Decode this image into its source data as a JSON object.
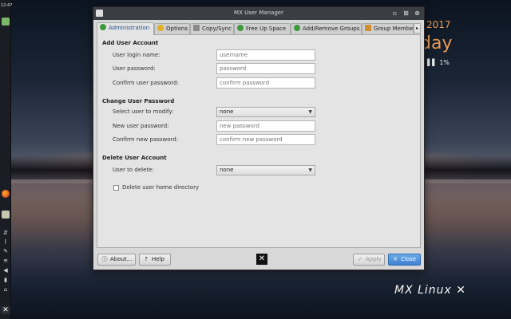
{
  "panel": {
    "clock": "12:47",
    "icons": [
      "users-icon",
      "firefox-icon",
      "files-icon",
      "network-icon",
      "bluetooth-icon",
      "clipboard-icon",
      "wifi-icon",
      "volume-icon",
      "battery-icon",
      "home-icon",
      "mx-menu-icon"
    ]
  },
  "desktop": {
    "conky_year": "2017",
    "conky_day": "day",
    "conky_percent_icon": "▐▐",
    "conky_percent": "1%",
    "brand": "MX Linux"
  },
  "window": {
    "title": "MX User Manager",
    "tabs": [
      {
        "label": "Administration",
        "icon": "user-admin-icon",
        "color": "#3d9a3d"
      },
      {
        "label": "Options",
        "icon": "options-icon",
        "color": "#e0b020"
      },
      {
        "label": "Copy/Sync",
        "icon": "copy-icon",
        "color": "#8a8a8a"
      },
      {
        "label": "Free Up Space",
        "icon": "user-icon",
        "color": "#3d9a3d"
      },
      {
        "label": "Add/Remove Groups",
        "icon": "group-icon",
        "color": "#3d9a3d"
      },
      {
        "label": "Group Members",
        "icon": "members-icon",
        "color": "#d09030"
      }
    ],
    "tab_scroll": "▸",
    "add_section": {
      "title": "Add User Account",
      "login_label": "User login name:",
      "login_placeholder": "username",
      "password_label": "User password:",
      "password_placeholder": "password",
      "confirm_label": "Confirm user password:",
      "confirm_placeholder": "confirm password"
    },
    "change_section": {
      "title": "Change User Password",
      "select_label": "Select user to modify:",
      "select_value": "none",
      "new_label": "New user password:",
      "new_placeholder": "new password",
      "confirm_label": "Confirm new password:",
      "confirm_placeholder": "confirm new password"
    },
    "delete_section": {
      "title": "Delete User Account",
      "user_label": "User to delete:",
      "user_value": "none",
      "home_dir_label": "Delete user home directory",
      "home_dir_checked": false
    },
    "buttons": {
      "about": "About...",
      "help": "Help",
      "apply": "Apply",
      "close": "Close"
    }
  }
}
